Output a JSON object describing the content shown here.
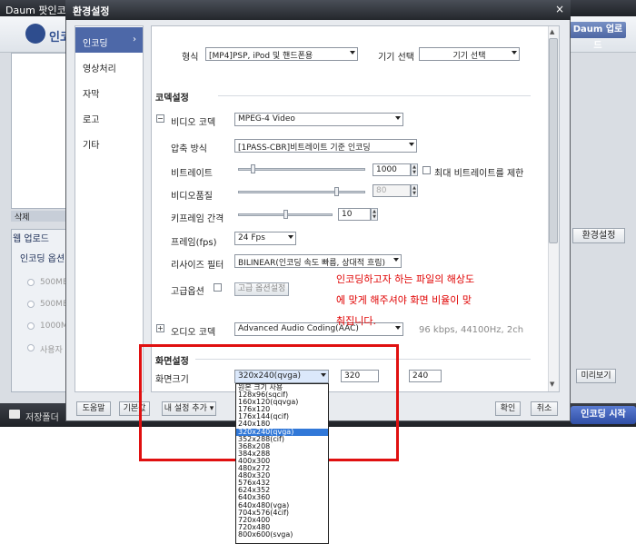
{
  "background_app": {
    "title": "Daum 팟인코더",
    "logo_text": "인코",
    "upload_button": "Daum 업로드",
    "list_controls": "삭제",
    "web_tab": "웹 업로드",
    "web_option": "인코딩 옵션",
    "radio_labels": [
      "500ME",
      "500ME",
      "1000M",
      "사용자"
    ],
    "settings_button": "환경설정",
    "preview_button": "미리보기",
    "save_folder": "저장폴더",
    "start_button": "인코딩 시작"
  },
  "dialog": {
    "title": "환경설정",
    "close": "×",
    "nav": [
      {
        "label": "인코딩",
        "active": true
      },
      {
        "label": "영상처리",
        "active": false
      },
      {
        "label": "자막",
        "active": false
      },
      {
        "label": "로고",
        "active": false
      },
      {
        "label": "기타",
        "active": false
      }
    ],
    "format_label": "형식",
    "format_value": "[MP4]PSP, iPod 및 핸드폰용",
    "device_label": "기기 선택",
    "device_value": "기기 선택",
    "codec_section": "코덱설정",
    "video_codec_label": "비디오 코덱",
    "video_codec_value": "MPEG-4 Video",
    "compression_label": "압축 방식",
    "compression_value": "[1PASS-CBR]비트레이트 기준 인코딩",
    "bitrate_label": "비트레이트",
    "bitrate_value": "1000",
    "bitrate_limit_label": "최대 비트레이트를 제한",
    "quality_label": "비디오품질",
    "quality_value": "80",
    "keyframe_label": "키프레임 간격",
    "keyframe_value": "10",
    "fps_label": "프레임(fps)",
    "fps_value": "24 Fps",
    "resize_label": "리사이즈 필터",
    "resize_value": "BILINEAR(인코딩 속도 빠름, 상대적 흐림)",
    "advanced_label": "고급옵션",
    "advanced_button": "고급 옵션설정",
    "audio_codec_label": "오디오 코덱",
    "audio_codec_value": "Advanced Audio Coding(AAC)",
    "audio_info": "96 kbps, 44100Hz, 2ch",
    "screen_section": "화면설정",
    "screen_size_label": "화면크기",
    "screen_size_value": "320x240(qvga)",
    "width_value": "320",
    "height_value": "240",
    "footer": {
      "help": "도움말",
      "default": "기본값",
      "add_preset": "내 설정 추가",
      "ok": "확인",
      "cancel": "취소"
    }
  },
  "annotation": {
    "note_lines": [
      "인코딩하고자 하는 파일의 해상도",
      "에 맞게 해주셔야 화면 비율이 맞",
      "춰집니다."
    ]
  },
  "resolution_dropdown": {
    "selected": "320x240(qvga)",
    "options": [
      "원본 크기 사용",
      "128x96(sqcif)",
      "160x120(qqvga)",
      "176x120",
      "176x144(qcif)",
      "240x180",
      "320x240(qvga)",
      "352x288(cif)",
      "368x208",
      "384x288",
      "400x300",
      "480x272",
      "480x320",
      "576x432",
      "624x352",
      "640x360",
      "640x480(vga)",
      "704x576(4cif)",
      "720x400",
      "720x480",
      "800x600(svga)"
    ]
  },
  "colors": {
    "accent": "#4d68a8",
    "annotation_red": "#e01010",
    "selection_blue": "#3178d8"
  }
}
